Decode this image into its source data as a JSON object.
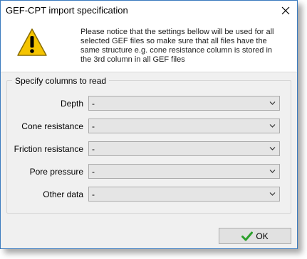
{
  "window": {
    "title": "GEF-CPT import specification"
  },
  "banner": {
    "message_lines": [
      "Please notice that the settings bellow will be used for all",
      "selected GEF files so make sure that all files have the",
      "same structure e.g. cone resistance column is stored in",
      "the 3rd column in all GEF files"
    ],
    "icon": "warning-icon"
  },
  "group": {
    "label": "Specify columns to read",
    "rows": [
      {
        "label": "Depth",
        "value": "-"
      },
      {
        "label": "Cone resistance",
        "value": "-"
      },
      {
        "label": "Friction resistance",
        "value": "-"
      },
      {
        "label": "Pore pressure",
        "value": "-"
      },
      {
        "label": "Other data",
        "value": "-"
      }
    ]
  },
  "buttons": {
    "ok_label": "OK",
    "ok_icon": "checkmark-icon",
    "close_icon": "close-icon"
  },
  "colors": {
    "accent": "#3b7bbf",
    "ok_check": "#2ca02c",
    "warning": "#f5c400"
  }
}
